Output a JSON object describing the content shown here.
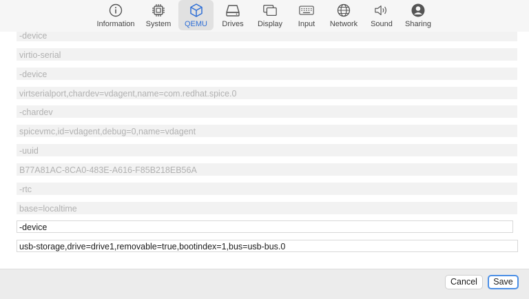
{
  "toolbar": {
    "items": [
      {
        "label": "Information",
        "icon": "info-icon"
      },
      {
        "label": "System",
        "icon": "cpu-icon"
      },
      {
        "label": "QEMU",
        "icon": "cube-icon",
        "selected": true
      },
      {
        "label": "Drives",
        "icon": "drive-icon"
      },
      {
        "label": "Display",
        "icon": "display-icon"
      },
      {
        "label": "Input",
        "icon": "keyboard-icon"
      },
      {
        "label": "Network",
        "icon": "globe-icon"
      },
      {
        "label": "Sound",
        "icon": "speaker-icon"
      },
      {
        "label": "Sharing",
        "icon": "person-icon"
      }
    ],
    "accent": "#2f6fd6"
  },
  "arguments": [
    {
      "value": "-device",
      "editable": false
    },
    {
      "value": "virtio-serial",
      "editable": false
    },
    {
      "value": "-device",
      "editable": false
    },
    {
      "value": "virtserialport,chardev=vdagent,name=com.redhat.spice.0",
      "editable": false
    },
    {
      "value": "-chardev",
      "editable": false
    },
    {
      "value": "spicevmc,id=vdagent,debug=0,name=vdagent",
      "editable": false
    },
    {
      "value": "-uuid",
      "editable": false
    },
    {
      "value": "B77A81AC-8CA0-483E-A616-F85B218EB56A",
      "editable": false
    },
    {
      "value": "-rtc",
      "editable": false
    },
    {
      "value": "base=localtime",
      "editable": false
    },
    {
      "value": "-device",
      "editable": true
    },
    {
      "value": "usb-storage,drive=drive1,removable=true,bootindex=1,bus=usb-bus.0",
      "editable": true
    }
  ],
  "footer": {
    "cancel_label": "Cancel",
    "save_label": "Save"
  }
}
